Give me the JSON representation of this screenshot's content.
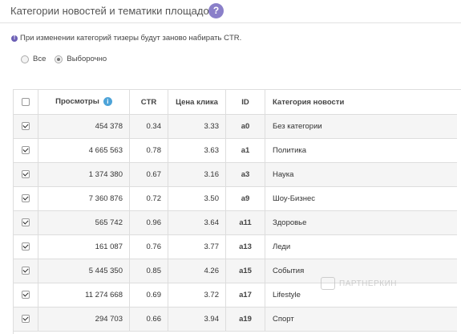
{
  "header": {
    "title": "Категории новостей и тематики площадок",
    "help_label": "?"
  },
  "notice": {
    "text": "При изменении категорий тизеры будут заново набирать CTR."
  },
  "filter": {
    "options": [
      {
        "label": "Все",
        "selected": false
      },
      {
        "label": "Выборочно",
        "selected": true
      }
    ]
  },
  "table": {
    "columns": {
      "views": "Просмотры",
      "ctr": "CTR",
      "price": "Цена клика",
      "id": "ID",
      "category": "Категория новости"
    },
    "rows": [
      {
        "checked": true,
        "views": "454 378",
        "ctr": "0.34",
        "price": "3.33",
        "id": "a0",
        "category": "Без категории"
      },
      {
        "checked": true,
        "views": "4 665 563",
        "ctr": "0.78",
        "price": "3.63",
        "id": "a1",
        "category": "Политика"
      },
      {
        "checked": true,
        "views": "1 374 380",
        "ctr": "0.67",
        "price": "3.16",
        "id": "a3",
        "category": "Наука"
      },
      {
        "checked": true,
        "views": "7 360 876",
        "ctr": "0.72",
        "price": "3.50",
        "id": "a9",
        "category": "Шоу-Бизнес"
      },
      {
        "checked": true,
        "views": "565 742",
        "ctr": "0.96",
        "price": "3.64",
        "id": "a11",
        "category": "Здоровье"
      },
      {
        "checked": true,
        "views": "161 087",
        "ctr": "0.76",
        "price": "3.77",
        "id": "a13",
        "category": "Леди"
      },
      {
        "checked": true,
        "views": "5 445 350",
        "ctr": "0.85",
        "price": "4.26",
        "id": "a15",
        "category": "События"
      },
      {
        "checked": true,
        "views": "11 274 668",
        "ctr": "0.69",
        "price": "3.72",
        "id": "a17",
        "category": "Lifestyle"
      },
      {
        "checked": true,
        "views": "294 703",
        "ctr": "0.66",
        "price": "3.94",
        "id": "a19",
        "category": "Спорт"
      }
    ]
  },
  "watermark": {
    "text": "ПАРТНЕРКИН"
  },
  "colors": {
    "accent": "#8a7fc9",
    "info": "#4da3d8",
    "stripe": "#f5f5f5"
  }
}
